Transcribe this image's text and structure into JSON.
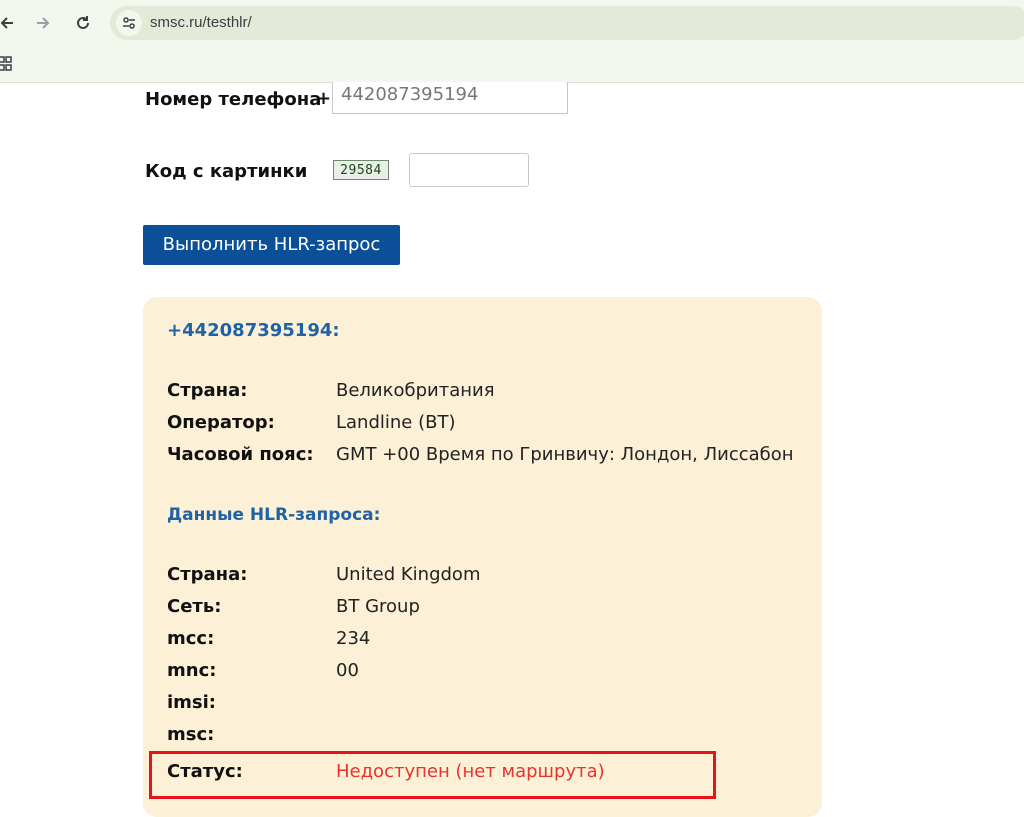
{
  "browser": {
    "url": "smsc.ru/testhlr/"
  },
  "form": {
    "phone_label": "Номер телефона",
    "plus": "+",
    "phone_value": "442087395194",
    "captcha_label": "Код с картинки",
    "captcha_code": "29584",
    "captcha_value": "",
    "submit_label": "Выполнить HLR-запрос"
  },
  "result": {
    "phone": "+442087395194:",
    "info": [
      {
        "label": "Страна:",
        "value": "Великобритания"
      },
      {
        "label": "Оператор:",
        "value": "Landline (BT)"
      },
      {
        "label": "Часовой пояс:",
        "value": "GMT +00 Время по Гринвичу: Лондон, Лиссабон"
      }
    ],
    "hlr_heading": "Данные HLR-запроса:",
    "hlr": [
      {
        "label": "Страна:",
        "value": "United Kingdom"
      },
      {
        "label": "Сеть:",
        "value": "BT Group"
      },
      {
        "label": "mcc:",
        "value": "234"
      },
      {
        "label": "mnc:",
        "value": "00"
      },
      {
        "label": "imsi:",
        "value": ""
      },
      {
        "label": "msc:",
        "value": ""
      }
    ],
    "status_label": "Статус:",
    "status_value": "Недоступен (нет маршрута)"
  },
  "colors": {
    "accent_blue": "#1f63a6",
    "button_blue": "#0b4f98",
    "panel_bg": "#fcf1d7",
    "status_red": "#e8322c",
    "highlight_red": "#e8121a"
  },
  "icons": [
    "back-arrow-icon",
    "forward-arrow-icon",
    "reload-icon",
    "site-info-icon",
    "apps-grid-icon"
  ]
}
